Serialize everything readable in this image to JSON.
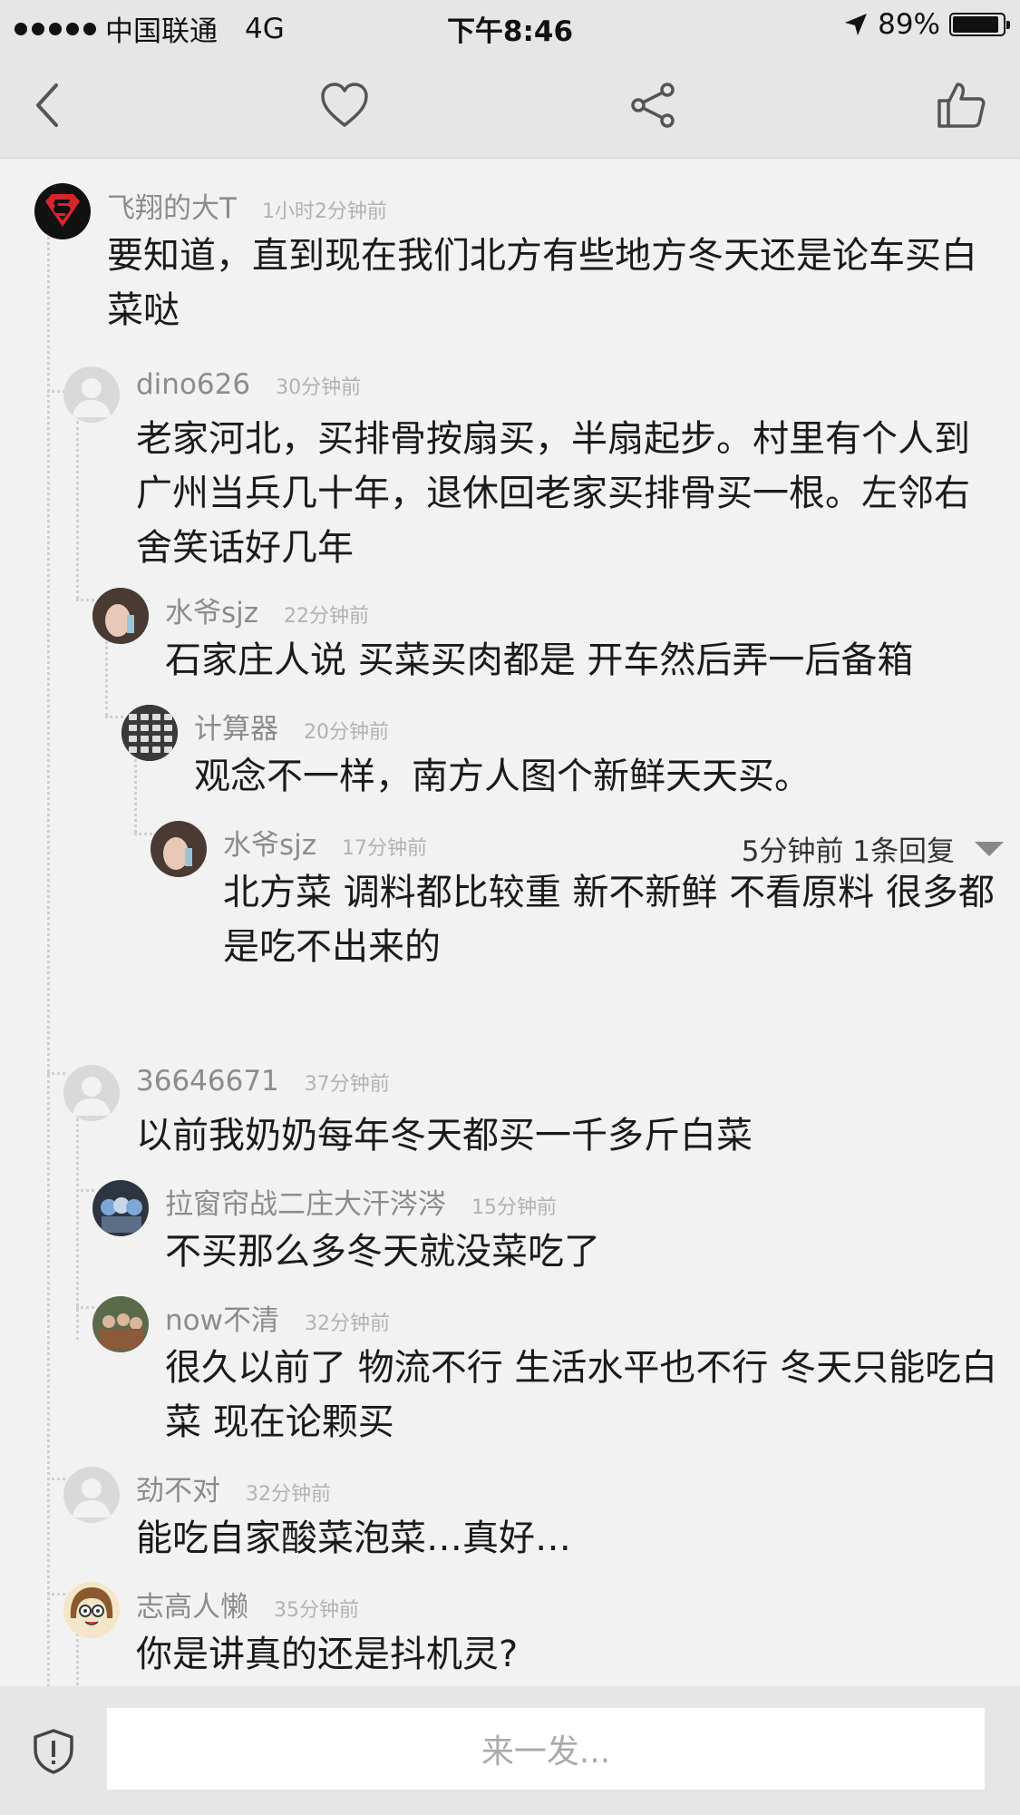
{
  "status": {
    "carrier": "中国联通",
    "network": "4G",
    "time": "下午8:46",
    "battery": "89%"
  },
  "nav": {
    "back_icon": "chevron-left-icon",
    "like_icon": "heart-icon",
    "share_icon": "share-icon",
    "thumb_icon": "thumbs-up-icon"
  },
  "comments": [
    {
      "user": "飞翔的大T",
      "time": "1小时2分钟前",
      "text": "要知道，直到现在我们北方有些地方冬天还是论车买白菜哒"
    },
    {
      "user": "dino626",
      "time": "30分钟前",
      "text": "老家河北，买排骨按扇买，半扇起步。村里有个人到广州当兵几十年，退休回老家买排骨买一根。左邻右舍笑话好几年"
    },
    {
      "user": "水爷sjz",
      "time": "22分钟前",
      "text": "石家庄人说 买菜买肉都是 开车然后弄一后备箱"
    },
    {
      "user": "计算器",
      "time": "20分钟前",
      "text": "观念不一样，南方人图个新鲜天天买。"
    },
    {
      "user": "水爷sjz",
      "time": "17分钟前",
      "text": "北方菜 调料都比较重 新不新鲜 不看原料 很多都是吃不出来的"
    },
    {
      "user": "36646671",
      "time": "37分钟前",
      "text": "以前我奶奶每年冬天都买一千多斤白菜"
    },
    {
      "user": "拉窗帘战二庄大汗涔涔",
      "time": "15分钟前",
      "text": "不买那么多冬天就没菜吃了"
    },
    {
      "user": "now不清",
      "time": "32分钟前",
      "text": "很久以前了 物流不行 生活水平也不行 冬天只能吃白菜 现在论颗买"
    },
    {
      "user": "劲不对",
      "time": "32分钟前",
      "text": "能吃自家酸菜泡菜…真好…"
    },
    {
      "user": "志高人懒",
      "time": "35分钟前",
      "text": "你是讲真的还是抖机灵?"
    }
  ],
  "more_replies": "5分钟前 1条回复",
  "input": {
    "placeholder": "来一发..."
  },
  "colors": {
    "background": "#f2f2f2",
    "bar": "#e6e6e6",
    "username": "#8c8c8c",
    "timestamp": "#b2b2b2"
  }
}
